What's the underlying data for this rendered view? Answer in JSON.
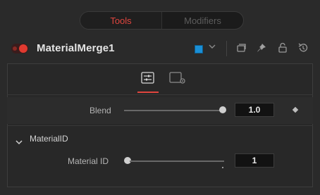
{
  "tabs": {
    "tools": "Tools",
    "modifiers": "Modifiers"
  },
  "header": {
    "node_title": "MaterialMerge1",
    "swatch_color": "#1a8fd6",
    "icons": [
      "toggle-icon",
      "color-swatch-icon",
      "chevron-down-icon",
      "versions-icon",
      "pin-icon",
      "lock-icon",
      "reset-icon"
    ]
  },
  "panel": {
    "subtabs": [
      "controls-tab-icon",
      "settings-tab-icon"
    ],
    "blend": {
      "label": "Blend",
      "value": "1.0",
      "slider_fraction": 1.0
    },
    "section": {
      "title": "MaterialID",
      "material_id": {
        "label": "Material ID",
        "value": "1",
        "slider_fraction": 0.0
      }
    }
  },
  "colors": {
    "accent": "#e0453e",
    "background": "#2a2a2a"
  }
}
